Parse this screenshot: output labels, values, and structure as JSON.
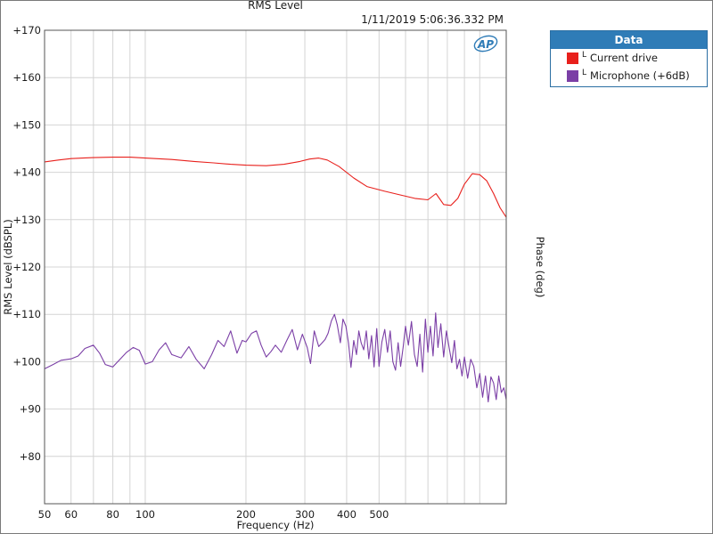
{
  "chart_data": {
    "type": "line",
    "title": "RMS Level",
    "timestamp": "1/11/2019 5:06:36.332 PM",
    "xlabel": "Frequency (Hz)",
    "ylabel": "RMS Level (dBSPL)",
    "ylabel_right": "Phase (deg)",
    "x_scale": "log",
    "xlim": [
      50,
      1200
    ],
    "ylim": [
      70,
      170
    ],
    "grid": true,
    "x_ticks": [
      {
        "value": 50,
        "label": "50"
      },
      {
        "value": 60,
        "label": "60"
      },
      {
        "value": 80,
        "label": "80"
      },
      {
        "value": 100,
        "label": "100"
      },
      {
        "value": 200,
        "label": "200"
      },
      {
        "value": 300,
        "label": "300"
      },
      {
        "value": 400,
        "label": "400"
      },
      {
        "value": 500,
        "label": "500"
      }
    ],
    "y_ticks": [
      {
        "value": 80,
        "label": "+80"
      },
      {
        "value": 90,
        "label": "+90"
      },
      {
        "value": 100,
        "label": "+100"
      },
      {
        "value": 110,
        "label": "+110"
      },
      {
        "value": 120,
        "label": "+120"
      },
      {
        "value": 130,
        "label": "+130"
      },
      {
        "value": 140,
        "label": "+140"
      },
      {
        "value": 150,
        "label": "+150"
      },
      {
        "value": 160,
        "label": "+160"
      },
      {
        "value": 170,
        "label": "+170"
      }
    ],
    "legend": {
      "title": "Data",
      "placement": "right"
    },
    "series": [
      {
        "name": "Current drive",
        "channel": "L",
        "color": "#e8201c",
        "x": [
          50,
          55,
          60,
          65,
          70,
          80,
          90,
          100,
          120,
          140,
          160,
          180,
          200,
          230,
          260,
          290,
          310,
          330,
          350,
          380,
          420,
          460,
          520,
          580,
          640,
          700,
          740,
          780,
          820,
          860,
          900,
          950,
          1000,
          1050,
          1100,
          1150,
          1200
        ],
        "values": [
          142.2,
          142.6,
          142.9,
          143.0,
          143.1,
          143.2,
          143.2,
          143.0,
          142.7,
          142.3,
          142.0,
          141.7,
          141.5,
          141.4,
          141.7,
          142.3,
          142.8,
          143.0,
          142.6,
          141.2,
          138.8,
          137.0,
          136.0,
          135.2,
          134.5,
          134.2,
          135.5,
          133.2,
          133.0,
          134.5,
          137.5,
          139.7,
          139.5,
          138.2,
          135.5,
          132.5,
          130.5
        ]
      },
      {
        "name": "Microphone (+6dB)",
        "channel": "L",
        "color": "#7b3fa6",
        "x": [
          50,
          53,
          56,
          60,
          63,
          66,
          70,
          73,
          76,
          80,
          84,
          88,
          92,
          96,
          100,
          105,
          110,
          115,
          120,
          128,
          135,
          142,
          150,
          158,
          165,
          172,
          180,
          188,
          195,
          200,
          208,
          215,
          222,
          230,
          238,
          245,
          255,
          265,
          275,
          285,
          295,
          305,
          312,
          320,
          330,
          338,
          345,
          352,
          360,
          368,
          375,
          383,
          390,
          398,
          405,
          412,
          420,
          428,
          435,
          442,
          450,
          458,
          466,
          475,
          483,
          492,
          500,
          510,
          520,
          530,
          540,
          550,
          560,
          570,
          580,
          590,
          600,
          612,
          625,
          638,
          650,
          662,
          675,
          688,
          700,
          712,
          725,
          738,
          750,
          765,
          780,
          795,
          810,
          825,
          840,
          855,
          870,
          885,
          900,
          920,
          940,
          960,
          980,
          1000,
          1020,
          1040,
          1060,
          1080,
          1100,
          1120,
          1140,
          1160,
          1180,
          1200
        ],
        "values": [
          98.5,
          99.4,
          100.3,
          100.6,
          101.2,
          102.8,
          103.5,
          101.8,
          99.4,
          98.9,
          100.5,
          102.0,
          103.0,
          102.4,
          99.5,
          100.0,
          102.5,
          104.0,
          101.5,
          100.8,
          103.2,
          100.5,
          98.5,
          101.5,
          104.5,
          103.2,
          106.5,
          101.8,
          104.5,
          104.2,
          106.0,
          106.5,
          103.5,
          101.0,
          102.2,
          103.5,
          102.0,
          104.5,
          106.8,
          102.5,
          105.8,
          103.0,
          99.6,
          106.5,
          103.2,
          104.0,
          104.7,
          106.0,
          108.6,
          110.0,
          107.8,
          104.0,
          109.0,
          107.5,
          104.0,
          98.8,
          104.5,
          101.5,
          106.5,
          104.0,
          102.5,
          106.5,
          100.6,
          105.5,
          98.9,
          107.0,
          99.0,
          104.2,
          106.8,
          102.0,
          106.5,
          100.0,
          98.2,
          104.0,
          99.0,
          103.0,
          107.5,
          103.5,
          108.5,
          101.5,
          99.0,
          105.8,
          97.8,
          109.0,
          102.0,
          107.5,
          101.2,
          110.3,
          103.0,
          108.0,
          101.0,
          106.5,
          103.0,
          99.8,
          104.5,
          98.5,
          100.5,
          97.0,
          101.0,
          96.5,
          100.5,
          99.0,
          94.5,
          97.5,
          92.5,
          97.0,
          91.5,
          96.8,
          95.5,
          92.0,
          97.0,
          93.5,
          94.5,
          92.0
        ]
      }
    ]
  }
}
